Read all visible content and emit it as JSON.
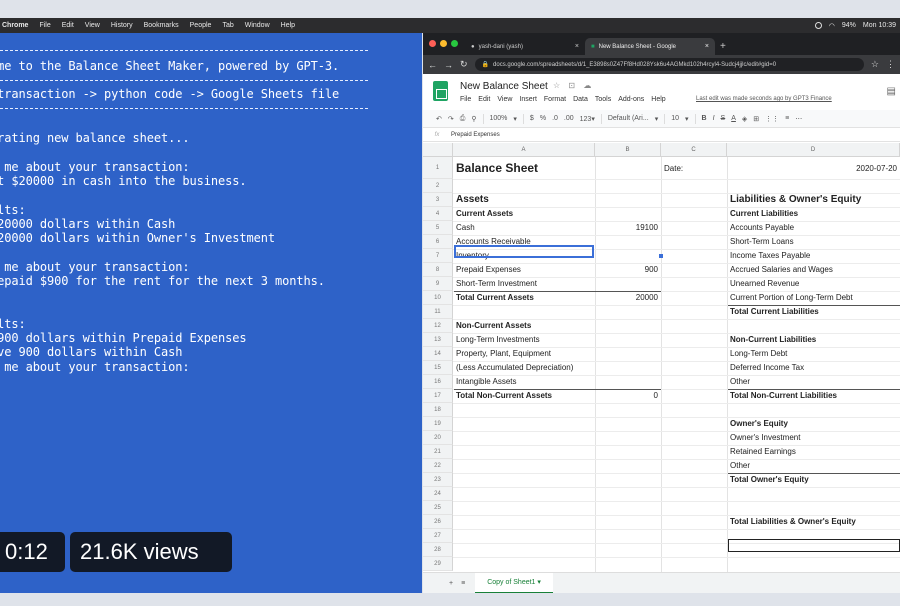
{
  "menubar": {
    "items": [
      "Chrome",
      "File",
      "Edit",
      "View",
      "History",
      "Bookmarks",
      "People",
      "Tab",
      "Window",
      "Help"
    ],
    "battery": "94%",
    "clock": "Mon 10:39"
  },
  "terminal": {
    "lines": [
      "ome to the Balance Sheet Maker, powered by GPT-3.",
      " transaction -> python code -> Google Sheets file",
      "erating new balance sheet...",
      "l me about your transaction:",
      "ut $20000 in cash into the business.",
      "ults:",
      " 20000 dollars within Cash",
      " 20000 dollars within Owner's Investment",
      "l me about your transaction:",
      "repaid $900 for the rent for the next 3 months.",
      "ults:",
      " 900 dollars within Prepaid Expenses",
      "ove 900 dollars within Cash",
      "l me about your transaction:"
    ]
  },
  "video": {
    "time": "0:12",
    "views": "21.6K views"
  },
  "browser": {
    "tab1": "yash-dani (yash)",
    "tab2": "New Balance Sheet - Google",
    "url": "docs.google.com/spreadsheets/d/1_E3898s0Z47Ff8Hd028Ysk6u4AGMkd102h4rcyl4-Sudcj4jjlc/edit#gid=0",
    "doc_title": "New Balance Sheet",
    "doc_icons": "☆ ⊡ ☁",
    "menus": [
      "File",
      "Edit",
      "View",
      "Insert",
      "Format",
      "Data",
      "Tools",
      "Add-ons",
      "Help"
    ],
    "last_edit": "Last edit was made seconds ago by GPT3 Finance",
    "toolbar": [
      "↶",
      "↷",
      "⎙",
      "⚲",
      "100%",
      "▾",
      "$",
      "%",
      ".0",
      ".00",
      "123▾",
      "Default (Ari...",
      "▾",
      "10",
      "▾",
      "B",
      "I",
      "S",
      "A",
      "◈",
      "⊞",
      "⋮⋮",
      "≡",
      "⋯"
    ],
    "formula": "Prepaid Expenses",
    "sheet_tab": "Copy of Sheet1 ▾"
  },
  "sheet": {
    "columns": [
      "",
      "A",
      "B",
      "C",
      "D"
    ],
    "rows": [
      "1",
      "2",
      "3",
      "4",
      "5",
      "6",
      "7",
      "8",
      "9",
      "10",
      "11",
      "12",
      "13",
      "14",
      "15",
      "16",
      "17",
      "18",
      "19",
      "20",
      "21",
      "22",
      "23",
      "24",
      "25",
      "26",
      "27",
      "28",
      "29"
    ],
    "cells": {
      "a1": "Balance Sheet",
      "c1": "Date:",
      "d1": "2020-07-20",
      "a3": "Assets",
      "d3": "Liabilities & Owner's Equity",
      "a4": "Current Assets",
      "d4": "Current Liabilities",
      "a5": "Cash",
      "b5": "19100",
      "d5": "Accounts Payable",
      "a6": "Accounts Receivable",
      "d6": "Short-Term Loans",
      "a7": "Inventory",
      "d7": "Income Taxes Payable",
      "a8": "Prepaid Expenses",
      "b8": "900",
      "d8": "Accrued Salaries and Wages",
      "a9": "Short-Term Investment",
      "d9": "Unearned Revenue",
      "a10": "Total Current Assets",
      "b10": "20000",
      "d10": "Current Portion of Long-Term Debt",
      "d11": "Total Current Liabilities",
      "a12": "Non-Current Assets",
      "d13": "Non-Current Liabilities",
      "a13": "Long-Term Investments",
      "a14": "Property, Plant, Equipment",
      "d14": "Long-Term Debt",
      "a15": "(Less Accumulated Depreciation)",
      "d15": "Deferred Income Tax",
      "a16": "Intangible Assets",
      "d16": "Other",
      "a17": "Total Non-Current Assets",
      "b17": "0",
      "d17": "Total Non-Current Liabilities",
      "d19": "Owner's Equity",
      "d20": "Owner's Investment",
      "d21": "Retained Earnings",
      "d22": "Other",
      "d23": "Total Owner's Equity",
      "d26": "Total Liabilities & Owner's Equity"
    }
  },
  "colors": {
    "terminal_bg": "#2e62c8",
    "sheets_green": "#1fa463",
    "selection": "#3b6fd8"
  }
}
